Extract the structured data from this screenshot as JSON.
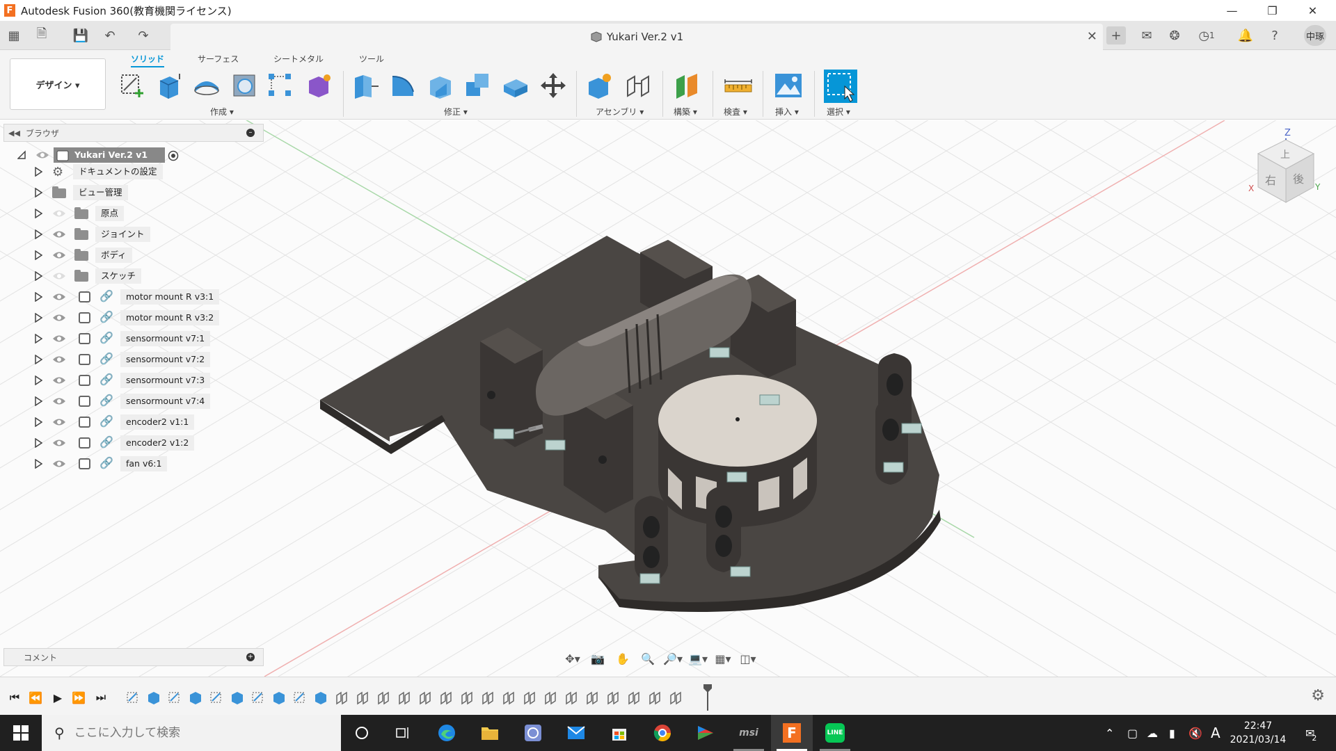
{
  "window": {
    "title": "Autodesk Fusion 360(教育機関ライセンス)",
    "logo_letter": "F",
    "controls": [
      "minimize",
      "maximize",
      "close"
    ]
  },
  "toolbar": {
    "document_title": "Yukari Ver.2 v1",
    "job_count": "1",
    "user_initials": "中琢"
  },
  "ribbon": {
    "workspace": "デザイン ▾",
    "tabs": [
      "ソリッド",
      "サーフェス",
      "シートメタル",
      "ツール"
    ],
    "active_tab": "ソリッド",
    "groups": {
      "create": "作成 ▾",
      "modify": "修正 ▾",
      "assemble": "アセンブリ ▾",
      "construct": "構築 ▾",
      "inspect": "検査 ▾",
      "insert": "挿入 ▾",
      "select": "選択 ▾"
    }
  },
  "browser": {
    "header": "ブラウザ",
    "root": "Yukari Ver.2 v1",
    "items": [
      {
        "label": "ドキュメントの設定",
        "kind": "settings",
        "visible": null
      },
      {
        "label": "ビュー管理",
        "kind": "folder",
        "visible": null
      },
      {
        "label": "原点",
        "kind": "folder",
        "visible": false
      },
      {
        "label": "ジョイント",
        "kind": "folder",
        "visible": true
      },
      {
        "label": "ボディ",
        "kind": "folder",
        "visible": true
      },
      {
        "label": "スケッチ",
        "kind": "folder",
        "visible": false
      },
      {
        "label": "motor mount R v3:1",
        "kind": "component",
        "visible": true
      },
      {
        "label": "motor mount R v3:2",
        "kind": "component",
        "visible": true
      },
      {
        "label": "sensormount v7:1",
        "kind": "component",
        "visible": true
      },
      {
        "label": "sensormount v7:2",
        "kind": "component",
        "visible": true
      },
      {
        "label": "sensormount v7:3",
        "kind": "component",
        "visible": true
      },
      {
        "label": "sensormount v7:4",
        "kind": "component",
        "visible": true
      },
      {
        "label": "encoder2 v1:1",
        "kind": "component",
        "visible": true
      },
      {
        "label": "encoder2 v1:2",
        "kind": "component",
        "visible": true
      },
      {
        "label": "fan v6:1",
        "kind": "component",
        "visible": true
      }
    ]
  },
  "comment_panel": {
    "header": "コメント"
  },
  "viewcube": {
    "top": "上",
    "right": "右",
    "back": "後",
    "axis_z": "Z",
    "axis_x": "X",
    "axis_y": "Y"
  },
  "taskbar": {
    "search_placeholder": "ここに入力して検索",
    "time": "22:47",
    "date": "2021/03/14",
    "ime": "A",
    "notifications": "2"
  },
  "colors": {
    "accent": "#0696d7",
    "model_dark": "#4a4643",
    "model_light": "#d9d4cd",
    "taskbar": "#202020"
  }
}
